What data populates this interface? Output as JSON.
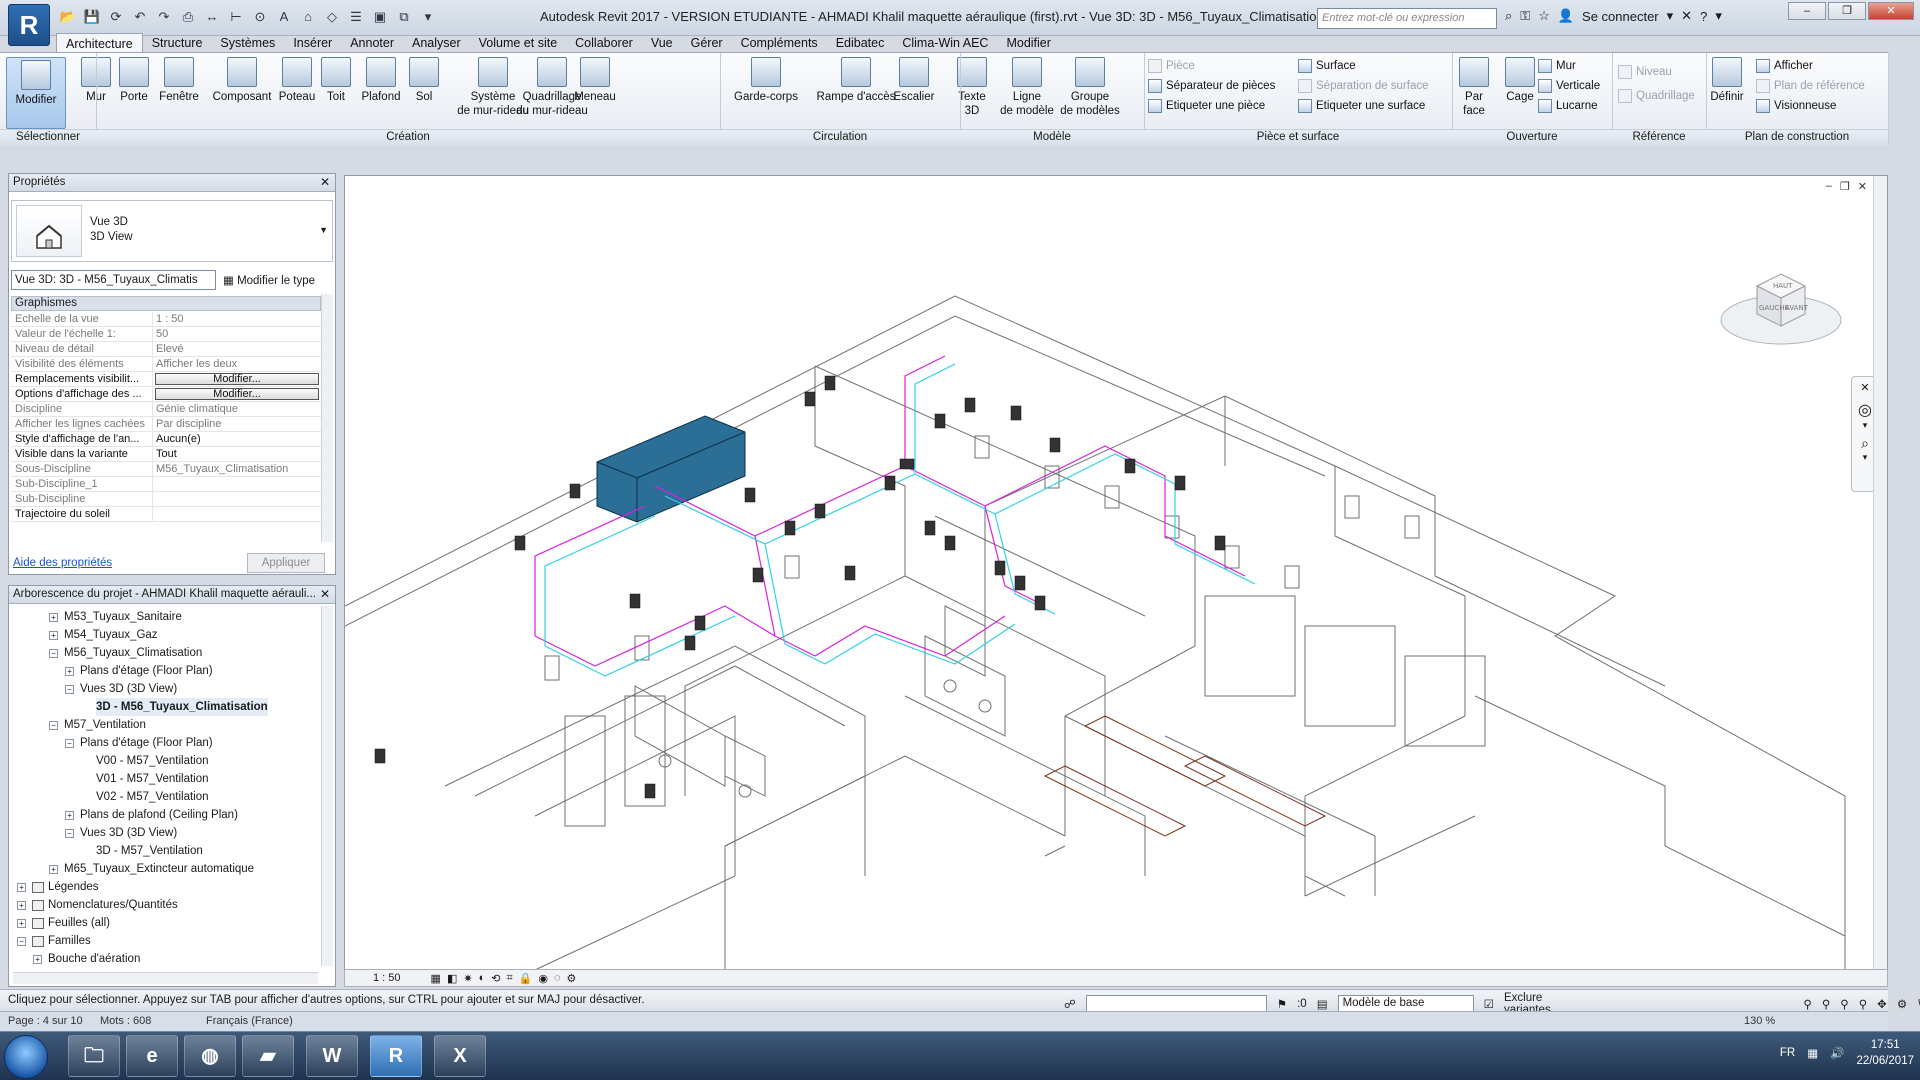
{
  "app": {
    "logo_letter": "R",
    "title": "Autodesk Revit 2017 - VERSION ETUDIANTE -     AHMADI Khalil maquette aéraulique (first).rvt - Vue 3D: 3D - M56_Tuyaux_Climatisation",
    "search_placeholder": "Entrez mot-clé ou expression",
    "signin": "Se connecter",
    "help": "?",
    "window_controls": [
      "–",
      "❐",
      "✕"
    ]
  },
  "tabs": [
    "Architecture",
    "Structure",
    "Systèmes",
    "Insérer",
    "Annoter",
    "Analyser",
    "Volume et site",
    "Collaborer",
    "Vue",
    "Gérer",
    "Compléments",
    "Edibatec",
    "Clima-Win AEC",
    "Modifier"
  ],
  "ribbon": {
    "big_buttons": [
      {
        "label": "Modifier"
      },
      {
        "label": "Mur"
      },
      {
        "label": "Porte"
      },
      {
        "label": "Fenêtre"
      },
      {
        "label": "Composant"
      },
      {
        "label": "Poteau"
      },
      {
        "label": "Toit"
      },
      {
        "label": "Plafond"
      },
      {
        "label": "Sol"
      },
      {
        "label": "Système\nde mur-rideau"
      },
      {
        "label": "Quadrillage\ndu mur-rideau"
      },
      {
        "label": "Meneau"
      },
      {
        "label": "Garde-corps"
      },
      {
        "label": "Rampe d'accès"
      },
      {
        "label": "Escalier"
      },
      {
        "label": "Texte\n3D"
      },
      {
        "label": "Ligne\nde modèle"
      },
      {
        "label": "Groupe\nde modèles"
      },
      {
        "label": "Par\nface"
      },
      {
        "label": "Cage"
      },
      {
        "label": "Définir"
      }
    ],
    "small_buttons": {
      "piece": [
        "Pièce",
        "Séparateur de pièces",
        "Etiqueter une pièce"
      ],
      "surface": [
        "Surface",
        "Séparation de surface",
        "Etiqueter une surface"
      ],
      "opening": [
        "Mur",
        "Verticale",
        "Lucarne"
      ],
      "datum": [
        "Niveau",
        "Quadrillage"
      ],
      "workplane": [
        "Afficher",
        "Plan de référence",
        "Visionneuse"
      ]
    },
    "groups": [
      "Sélectionner",
      "Création",
      "Circulation",
      "Modèle",
      "Pièce et surface",
      "Ouverture",
      "Référence",
      "Plan de construction"
    ]
  },
  "properties": {
    "title": "Propriétés",
    "type_line1": "Vue 3D",
    "type_line2": "3D View",
    "view_selector": "Vue 3D: 3D - M56_Tuyaux_Climatis",
    "edit_type": "Modifier le type",
    "category": "Graphismes",
    "rows": [
      {
        "k": "Echelle de la vue",
        "v": "1 : 50",
        "strong": false
      },
      {
        "k": "Valeur de l'échelle    1:",
        "v": "50",
        "strong": false
      },
      {
        "k": "Niveau de détail",
        "v": "Elevé",
        "strong": false
      },
      {
        "k": "Visibilité des éléments",
        "v": "Afficher les deux",
        "strong": false
      },
      {
        "k": "Remplacements visibilit...",
        "v": "Modifier...",
        "strong": true,
        "button": true
      },
      {
        "k": "Options d'affichage des ...",
        "v": "Modifier...",
        "strong": true,
        "button": true
      },
      {
        "k": "Discipline",
        "v": "Génie climatique",
        "strong": false
      },
      {
        "k": "Afficher les lignes cachées",
        "v": "Par discipline",
        "strong": false
      },
      {
        "k": "Style d'affichage de l'an...",
        "v": "Aucun(e)",
        "strong": true
      },
      {
        "k": "Visible dans la variante",
        "v": "Tout",
        "strong": true
      },
      {
        "k": "Sous-Discipline",
        "v": "M56_Tuyaux_Climatisation",
        "strong": false
      },
      {
        "k": "Sub-Discipline_1",
        "v": "",
        "strong": false
      },
      {
        "k": "Sub-Discipline",
        "v": "",
        "strong": false
      },
      {
        "k": "Trajectoire du soleil",
        "v": "",
        "strong": true
      }
    ],
    "help_link": "Aide des propriétés",
    "apply": "Appliquer"
  },
  "browser": {
    "title": "Arborescence du projet - AHMADI Khalil maquette aérauli...",
    "nodes": [
      {
        "label": "M53_Tuyaux_Sanitaire",
        "level": 2,
        "toggle": "+"
      },
      {
        "label": "M54_Tuyaux_Gaz",
        "level": 2,
        "toggle": "+"
      },
      {
        "label": "M56_Tuyaux_Climatisation",
        "level": 2,
        "toggle": "−"
      },
      {
        "label": "Plans d'étage (Floor Plan)",
        "level": 3,
        "toggle": "+"
      },
      {
        "label": "Vues 3D (3D View)",
        "level": 3,
        "toggle": "−"
      },
      {
        "label": "3D - M56_Tuyaux_Climatisation",
        "level": 4,
        "toggle": "",
        "selected": true
      },
      {
        "label": "M57_Ventilation",
        "level": 2,
        "toggle": "−"
      },
      {
        "label": "Plans d'étage (Floor Plan)",
        "level": 3,
        "toggle": "−"
      },
      {
        "label": "V00 - M57_Ventilation",
        "level": 4,
        "toggle": ""
      },
      {
        "label": "V01 - M57_Ventilation",
        "level": 4,
        "toggle": ""
      },
      {
        "label": "V02 - M57_Ventilation",
        "level": 4,
        "toggle": ""
      },
      {
        "label": "Plans de plafond (Ceiling Plan)",
        "level": 3,
        "toggle": "+"
      },
      {
        "label": "Vues 3D (3D View)",
        "level": 3,
        "toggle": "−"
      },
      {
        "label": "3D - M57_Ventilation",
        "level": 4,
        "toggle": ""
      },
      {
        "label": "M65_Tuyaux_Extincteur automatique",
        "level": 2,
        "toggle": "+"
      },
      {
        "label": "Légendes",
        "level": 0,
        "toggle": "+",
        "icon": true
      },
      {
        "label": "Nomenclatures/Quantités",
        "level": 0,
        "toggle": "+",
        "icon": true
      },
      {
        "label": "Feuilles (all)",
        "level": 0,
        "toggle": "+",
        "icon": true
      },
      {
        "label": "Familles",
        "level": 0,
        "toggle": "−",
        "icon": true
      },
      {
        "label": "Bouche d'aération",
        "level": 1,
        "toggle": "+"
      }
    ]
  },
  "viewport": {
    "controls": [
      "–",
      "❐",
      "✕"
    ],
    "viewcube_top": "HAUT",
    "viewcube_left": "GAUCHE",
    "viewcube_front": "AVANT",
    "scale": "1 : 50",
    "duct_color_magenta": "#d81ee0",
    "duct_color_cyan": "#2fd0e8",
    "unit_color": "#2b6f97"
  },
  "status": {
    "hint": "Cliquez pour sélectionner. Appuyez sur TAB pour afficher d'autres options, sur CTRL pour ajouter et sur MAJ pour désactiver.",
    "workset_count": ":0",
    "model": "Modèle de base",
    "exclude_variants": "Exclure variantes",
    "filter_count": ":0"
  },
  "wordbar": {
    "page": "Page : 4 sur 10",
    "words": "Mots : 608",
    "language": "Français (France)",
    "zoom": "130 %"
  },
  "taskbar": {
    "apps": [
      "explorer",
      "ie",
      "firefox",
      "revit-viewer",
      "W",
      "R",
      "X"
    ],
    "lang": "FR",
    "time": "17:51",
    "date": "22/06/2017"
  }
}
